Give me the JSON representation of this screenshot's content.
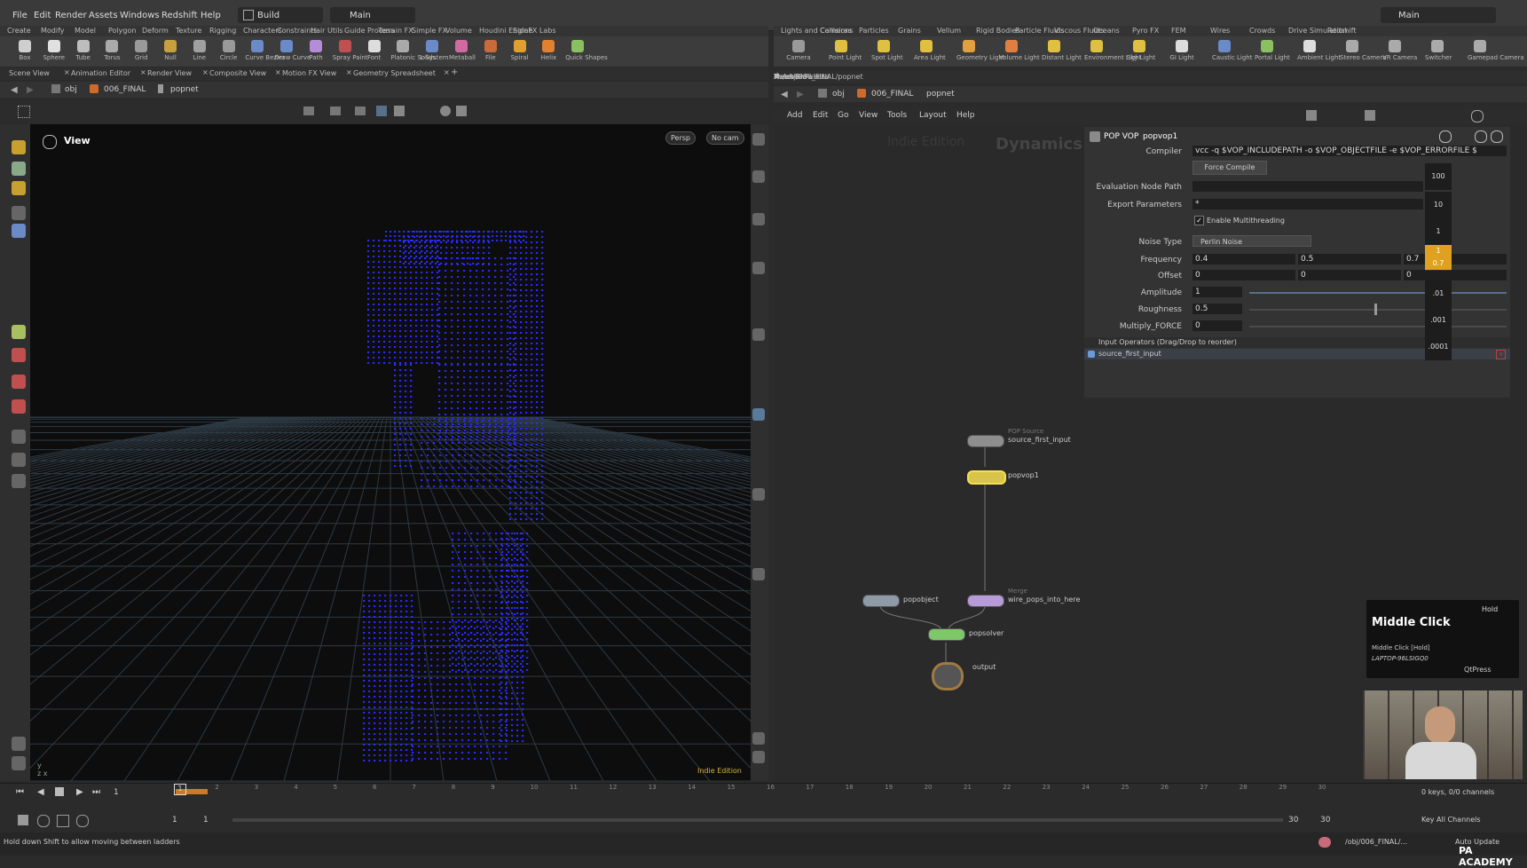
{
  "menu": [
    "File",
    "Edit",
    "Render",
    "Assets",
    "Windows",
    "Redshift",
    "Help"
  ],
  "desktop": {
    "left": "Build",
    "right": "Main",
    "top_right": "Main"
  },
  "shelf_left_tabs": [
    "Create",
    "Modify",
    "Model",
    "Polygon",
    "Deform",
    "Texture",
    "Rigging",
    "Characters",
    "Constraints",
    "Hair Utils",
    "Guide Process",
    "Terrain FX",
    "Simple FX",
    "Volume",
    "Houdini Engine",
    "SideFX Labs"
  ],
  "shelf_left_tools": [
    "Box",
    "Sphere",
    "Tube",
    "Torus",
    "Grid",
    "Null",
    "Line",
    "Circle",
    "Curve Bezier",
    "Draw Curve",
    "Path",
    "Spray Paint",
    "Font",
    "Platonic Solids",
    "L-System",
    "Metaball",
    "File",
    "Spiral",
    "Helix",
    "Quick Shapes"
  ],
  "shelf_right_tabs": [
    "Lights and Cameras",
    "Collisions",
    "Particles",
    "Grains",
    "Vellum",
    "Rigid Bodies",
    "Particle Fluids",
    "Viscous Fluids",
    "Oceans",
    "Pyro FX",
    "FEM",
    "Wires",
    "Crowds",
    "Drive Simulation",
    "Redshift"
  ],
  "shelf_right_tools": [
    "Camera",
    "Point Light",
    "Spot Light",
    "Area Light",
    "Geometry Light",
    "Volume Light",
    "Distant Light",
    "Environment Light",
    "Sky Light",
    "GI Light",
    "Caustic Light",
    "Portal Light",
    "Ambient Light",
    "Stereo Camera",
    "VR Camera",
    "Switcher",
    "Gamepad Camera"
  ],
  "pane_tabs_left": [
    "Scene View",
    "Animation Editor",
    "Render View",
    "Composite View",
    "Motion FX View",
    "Geometry Spreadsheet"
  ],
  "pane_tabs_right": [
    "/obj/006_FINAL/popnet",
    "Tree View",
    "Material Palette",
    "Asset Browser"
  ],
  "path_left": [
    "obj",
    "006_FINAL",
    "popnet"
  ],
  "path_right": [
    "obj",
    "006_FINAL",
    "popnet"
  ],
  "viewport": {
    "title": "View",
    "persp": "Persp",
    "cam": "No cam",
    "edition": "Indie Edition"
  },
  "network_menu": [
    "Add",
    "Edit",
    "Go",
    "View",
    "Tools",
    "Layout",
    "Help"
  ],
  "network_watermark": {
    "edition": "Indie Edition",
    "context": "Dynamics"
  },
  "params": {
    "type": "POP VOP",
    "name": "popvop1",
    "compiler_label": "Compiler",
    "compiler": "vcc -q $VOP_INCLUDEPATH -o $VOP_OBJECTFILE -e $VOP_ERRORFILE $",
    "force_compile": "Force Compile",
    "eval_path_label": "Evaluation Node Path",
    "export_label": "Export Parameters",
    "export": "*",
    "multithread": "Enable Multithreading",
    "noise_type_label": "Noise Type",
    "noise_type": "Perlin Noise",
    "frequency_label": "Frequency",
    "frequency": [
      "0.4",
      "0.5",
      "0.7"
    ],
    "offset_label": "Offset",
    "offset": [
      "0",
      "0",
      "0"
    ],
    "amplitude_label": "Amplitude",
    "amplitude": "1",
    "roughness_label": "Roughness",
    "roughness": "0.5",
    "multiply_label": "Multiply_FORCE",
    "multiply": "0",
    "input_ops": "Input Operators (Drag/Drop to reorder)",
    "input_item": "source_first_input"
  },
  "ladder": [
    "100",
    "10",
    "1",
    "1",
    "0.7",
    ".01",
    ".001",
    ".0001"
  ],
  "nodes": [
    {
      "name": "source_first_input",
      "sub": "POP Source",
      "color": "#8e8e8e"
    },
    {
      "name": "popvop1",
      "sub": "",
      "color": "#d8c44a"
    },
    {
      "name": "popobject",
      "sub": "",
      "color": "#8e9aa8"
    },
    {
      "name": "wire_pops_into_here",
      "sub": "Merge",
      "color": "#b79ad8"
    },
    {
      "name": "popsolver",
      "sub": "",
      "color": "#7fc86a"
    },
    {
      "name": "output",
      "sub": "",
      "color": "#a08060"
    }
  ],
  "hotkey": {
    "title": "Middle Click",
    "hold": "Hold",
    "line1": "Middle Click [Hold]",
    "line2": "LAPTOP-96LSIGQ0",
    "line3": "QtPress"
  },
  "timeline": {
    "frame": "1",
    "start": "1",
    "start2": "1",
    "end": "30",
    "end2": "30",
    "ticks": [
      "1",
      "2",
      "3",
      "4",
      "5",
      "6",
      "7",
      "8",
      "9",
      "10",
      "11",
      "12",
      "13",
      "14",
      "15",
      "16",
      "17",
      "18",
      "19",
      "20",
      "21",
      "22",
      "23",
      "24",
      "25",
      "26",
      "27",
      "28",
      "29",
      "30"
    ],
    "keys": "0 keys, 0/0 channels",
    "key_all": "Key All Channels"
  },
  "status": {
    "message": "Hold down Shift to allow moving between ladders",
    "path": "/obj/006_FINAL/...",
    "auto_update": "Auto Update",
    "brand": "PA ACADEMY"
  },
  "colors": {
    "points": "#2a2aff",
    "node_selected": "#f4e04d"
  }
}
